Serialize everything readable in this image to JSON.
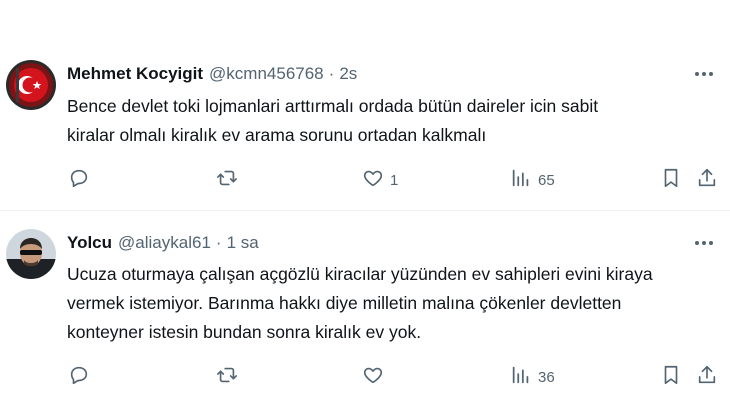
{
  "tweets": [
    {
      "author_name": "Mehmet Kocyigit",
      "handle": "@kcmn456768",
      "separator": "·",
      "time": "2s",
      "text_lines": [
        "Bence devlet toki lojmanlari arttırmalı ordada bütün daireler icin sabit",
        "kiralar olmalı kiralık ev arama sorunu ortadan kalkmalı"
      ],
      "reply_count": "",
      "retweet_count": "",
      "like_count": "1",
      "view_count": "65"
    },
    {
      "author_name": "Yolcu",
      "handle": "@aliaykal61",
      "separator": "·",
      "time": "1 sa",
      "text_lines": [
        "Ucuza oturmaya çalışan açgözlü kiracılar yüzünden ev sahipleri evini kiraya",
        "vermek istemiyor. Barınma hakkı diye milletin malına çökenler devletten",
        "konteyner istesin bundan sonra kiralık ev yok."
      ],
      "reply_count": "",
      "retweet_count": "",
      "like_count": "",
      "view_count": "36"
    }
  ],
  "icons": {
    "reply": "reply-icon",
    "retweet": "retweet-icon",
    "like": "heart-icon",
    "views": "views-icon",
    "bookmark": "bookmark-icon",
    "share": "share-icon",
    "more": "more-icon"
  },
  "colors": {
    "text": "#0f1419",
    "secondary": "#536471",
    "divider": "#eff3f4"
  }
}
